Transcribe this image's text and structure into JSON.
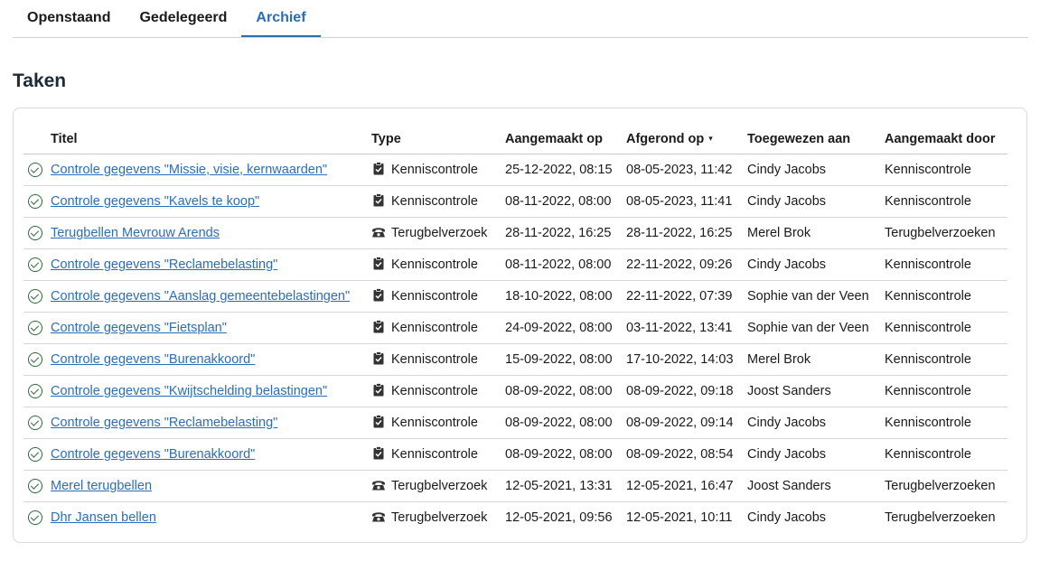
{
  "tabs": [
    {
      "label": "Openstaand"
    },
    {
      "label": "Gedelegeerd"
    },
    {
      "label": "Archief"
    }
  ],
  "active_tab": "Archief",
  "section": {
    "title": "Taken"
  },
  "table": {
    "headers": {
      "title": "Titel",
      "type": "Type",
      "created": "Aangemaakt op",
      "done": "Afgerond op",
      "assignee": "Toegewezen aan",
      "creator": "Aangemaakt door"
    },
    "sort_icon": "▾",
    "rows": [
      {
        "title": "Controle gegevens \"Missie, visie, kernwaarden\"",
        "type": "Kenniscontrole",
        "type_icon": "clipboard-check-icon",
        "created": "25-12-2022, 08:15",
        "done": "08-05-2023, 11:42",
        "assignee": "Cindy Jacobs",
        "creator": "Kenniscontrole"
      },
      {
        "title": "Controle gegevens \"Kavels te koop\"",
        "type": "Kenniscontrole",
        "type_icon": "clipboard-check-icon",
        "created": "08-11-2022, 08:00",
        "done": "08-05-2023, 11:41",
        "assignee": "Cindy Jacobs",
        "creator": "Kenniscontrole"
      },
      {
        "title": "Terugbellen Mevrouw Arends",
        "type": "Terugbelverzoek",
        "type_icon": "phone-icon",
        "created": "28-11-2022, 16:25",
        "done": "28-11-2022, 16:25",
        "assignee": "Merel Brok",
        "creator": "Terugbelverzoeken"
      },
      {
        "title": "Controle gegevens \"Reclamebelasting\"",
        "type": "Kenniscontrole",
        "type_icon": "clipboard-check-icon",
        "created": "08-11-2022, 08:00",
        "done": "22-11-2022, 09:26",
        "assignee": "Cindy Jacobs",
        "creator": "Kenniscontrole"
      },
      {
        "title": "Controle gegevens \"Aanslag gemeentebelastingen\"",
        "type": "Kenniscontrole",
        "type_icon": "clipboard-check-icon",
        "created": "18-10-2022, 08:00",
        "done": "22-11-2022, 07:39",
        "assignee": "Sophie van der Veen",
        "creator": "Kenniscontrole"
      },
      {
        "title": "Controle gegevens \"Fietsplan\"",
        "type": "Kenniscontrole",
        "type_icon": "clipboard-check-icon",
        "created": "24-09-2022, 08:00",
        "done": "03-11-2022, 13:41",
        "assignee": "Sophie van der Veen",
        "creator": "Kenniscontrole"
      },
      {
        "title": "Controle gegevens \"Burenakkoord\"",
        "type": "Kenniscontrole",
        "type_icon": "clipboard-check-icon",
        "created": "15-09-2022, 08:00",
        "done": "17-10-2022, 14:03",
        "assignee": "Merel Brok",
        "creator": "Kenniscontrole"
      },
      {
        "title": "Controle gegevens \"Kwijtschelding belastingen\"",
        "type": "Kenniscontrole",
        "type_icon": "clipboard-check-icon",
        "created": "08-09-2022, 08:00",
        "done": "08-09-2022, 09:18",
        "assignee": "Joost Sanders",
        "creator": "Kenniscontrole"
      },
      {
        "title": "Controle gegevens \"Reclamebelasting\"",
        "type": "Kenniscontrole",
        "type_icon": "clipboard-check-icon",
        "created": "08-09-2022, 08:00",
        "done": "08-09-2022, 09:14",
        "assignee": "Cindy Jacobs",
        "creator": "Kenniscontrole"
      },
      {
        "title": "Controle gegevens \"Burenakkoord\"",
        "type": "Kenniscontrole",
        "type_icon": "clipboard-check-icon",
        "created": "08-09-2022, 08:00",
        "done": "08-09-2022, 08:54",
        "assignee": "Cindy Jacobs",
        "creator": "Kenniscontrole"
      },
      {
        "title": "Merel terugbellen",
        "type": "Terugbelverzoek",
        "type_icon": "phone-icon",
        "created": "12-05-2021, 13:31",
        "done": "12-05-2021, 16:47",
        "assignee": "Joost Sanders",
        "creator": "Terugbelverzoeken"
      },
      {
        "title": "Dhr Jansen bellen",
        "type": "Terugbelverzoek",
        "type_icon": "phone-icon",
        "created": "12-05-2021, 09:56",
        "done": "12-05-2021, 10:11",
        "assignee": "Cindy Jacobs",
        "creator": "Terugbelverzoeken"
      }
    ]
  }
}
